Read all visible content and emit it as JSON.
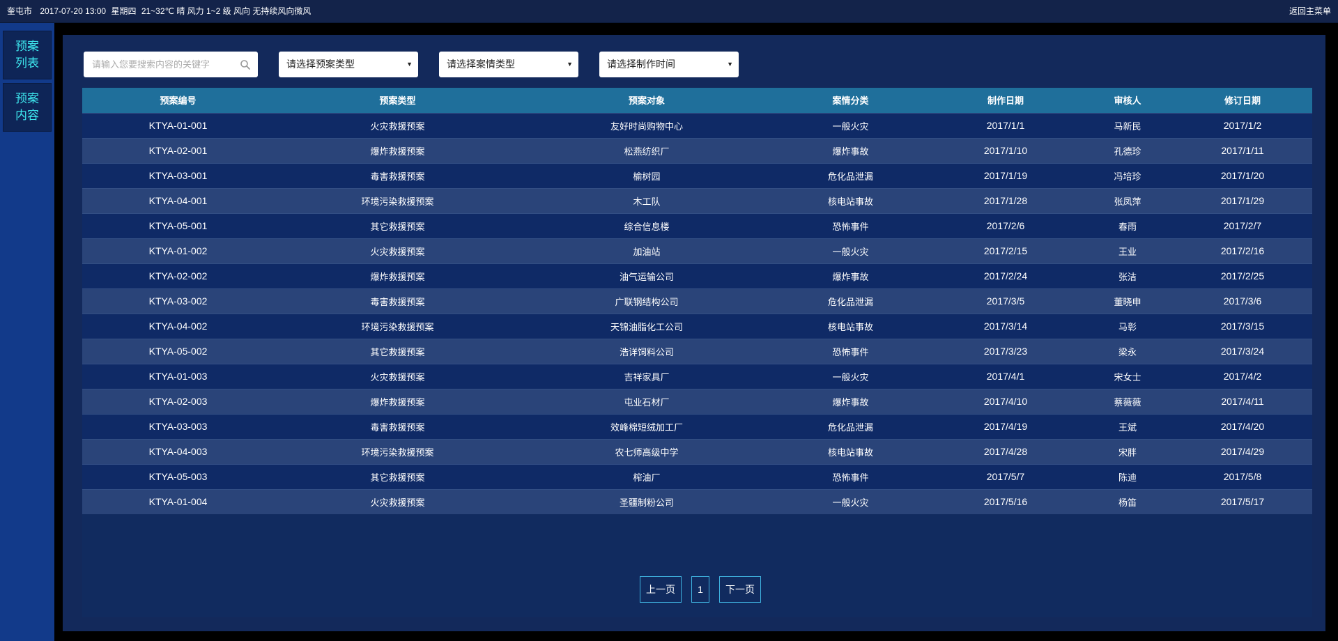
{
  "topbar": {
    "city": "奎屯市",
    "datetime": "2017-07-20 13:00",
    "weekday": "星期四",
    "weather": "21~32℃ 晴 风力 1~2 级 风向 无持续风向微风",
    "back_label": "返回主菜单"
  },
  "sidebar": {
    "items": [
      {
        "label": "预案列表"
      },
      {
        "label": "预案内容"
      }
    ]
  },
  "filters": {
    "search_placeholder": "请输入您要搜索内容的关键字",
    "plan_type": "请选择预案类型",
    "case_type": "请选择案情类型",
    "make_time": "请选择制作时间"
  },
  "table": {
    "headers": [
      "预案编号",
      "预案类型",
      "预案对象",
      "案情分类",
      "制作日期",
      "审核人",
      "修订日期"
    ],
    "rows": [
      [
        "KTYA-01-001",
        "火灾救援预案",
        "友好时尚购物中心",
        "一般火灾",
        "2017/1/1",
        "马新民",
        "2017/1/2"
      ],
      [
        "KTYA-02-001",
        "爆炸救援预案",
        "松燕纺织厂",
        "爆炸事故",
        "2017/1/10",
        "孔德珍",
        "2017/1/11"
      ],
      [
        "KTYA-03-001",
        "毒害救援预案",
        "榆树园",
        "危化品泄漏",
        "2017/1/19",
        "冯培珍",
        "2017/1/20"
      ],
      [
        "KTYA-04-001",
        "环境污染救援预案",
        "木工队",
        "核电站事故",
        "2017/1/28",
        "张凤萍",
        "2017/1/29"
      ],
      [
        "KTYA-05-001",
        "其它救援预案",
        "综合信息楼",
        "恐怖事件",
        "2017/2/6",
        "春雨",
        "2017/2/7"
      ],
      [
        "KTYA-01-002",
        "火灾救援预案",
        "加油站",
        "一般火灾",
        "2017/2/15",
        "王业",
        "2017/2/16"
      ],
      [
        "KTYA-02-002",
        "爆炸救援预案",
        "油气运输公司",
        "爆炸事故",
        "2017/2/24",
        "张洁",
        "2017/2/25"
      ],
      [
        "KTYA-03-002",
        "毒害救援预案",
        "广联钢结构公司",
        "危化品泄漏",
        "2017/3/5",
        "董晓申",
        "2017/3/6"
      ],
      [
        "KTYA-04-002",
        "环境污染救援预案",
        "天锦油脂化工公司",
        "核电站事故",
        "2017/3/14",
        "马彰",
        "2017/3/15"
      ],
      [
        "KTYA-05-002",
        "其它救援预案",
        "浩详饲料公司",
        "恐怖事件",
        "2017/3/23",
        "梁永",
        "2017/3/24"
      ],
      [
        "KTYA-01-003",
        "火灾救援预案",
        "吉祥家具厂",
        "一般火灾",
        "2017/4/1",
        "宋女士",
        "2017/4/2"
      ],
      [
        "KTYA-02-003",
        "爆炸救援预案",
        "屯业石材厂",
        "爆炸事故",
        "2017/4/10",
        "蔡薇薇",
        "2017/4/11"
      ],
      [
        "KTYA-03-003",
        "毒害救援预案",
        "效峰棉短绒加工厂",
        "危化品泄漏",
        "2017/4/19",
        "王斌",
        "2017/4/20"
      ],
      [
        "KTYA-04-003",
        "环境污染救援预案",
        "农七师高级中学",
        "核电站事故",
        "2017/4/28",
        "宋胖",
        "2017/4/29"
      ],
      [
        "KTYA-05-003",
        "其它救援预案",
        "榨油厂",
        "恐怖事件",
        "2017/5/7",
        "陈迪",
        "2017/5/8"
      ],
      [
        "KTYA-01-004",
        "火灾救援预案",
        "圣疆制粉公司",
        "一般火灾",
        "2017/5/16",
        "杨笛",
        "2017/5/17"
      ]
    ]
  },
  "pager": {
    "prev": "上一页",
    "page": "1",
    "next": "下一页"
  }
}
